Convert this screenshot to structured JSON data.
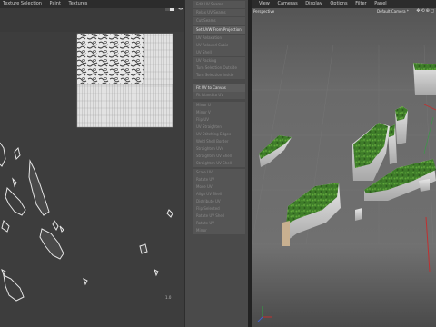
{
  "uv_menu": {
    "items": [
      "Texture Selection",
      "Paint",
      "Textures"
    ]
  },
  "uv_toolbar": {
    "icons": [
      "checkerboard-icon",
      "target-icon"
    ]
  },
  "uv_area": {
    "corner_label": "1.0"
  },
  "tools": {
    "items": [
      "Edit UV Seams",
      "Relax UV Seams",
      "Cut Seams",
      "Set UVW From Projection",
      "UV Relaxation",
      "UV Relaxed Cubic",
      "UV Shell",
      "UV Packing",
      "Turn Selection Outside",
      "Turn Selection Inside",
      "Fit UV to Canvas",
      "Fit Island to UV",
      "Mirror U",
      "Mirror V",
      "Flip UV",
      "UV Straighten",
      "UV Stitching Edges",
      "Weld Shell Border",
      "Straighten UVs",
      "Straighten UV Shell",
      "Straighten UV Shell",
      "Scale UV",
      "Rotate UV",
      "Move UV",
      "Align UV Shell",
      "Distribute UV",
      "Flip Selected",
      "Rotate UV Shell",
      "Rotate UV",
      "Mirror"
    ],
    "active_orange": "Set UVW From Projection",
    "active_white": "Fit UV to Canvas"
  },
  "viewport_menu": {
    "items": [
      "View",
      "Cameras",
      "Display",
      "Options",
      "Filter",
      "Panel"
    ]
  },
  "viewport": {
    "name": "Perspective",
    "camera": "Default Camera *",
    "nav_icons": "✥⟲⊕◻"
  },
  "colors": {
    "accent": "#e8a030",
    "grass": "#3f7d2a",
    "axis_red": "#c03030",
    "axis_green": "#30a040",
    "axis_blue": "#4060d0"
  }
}
